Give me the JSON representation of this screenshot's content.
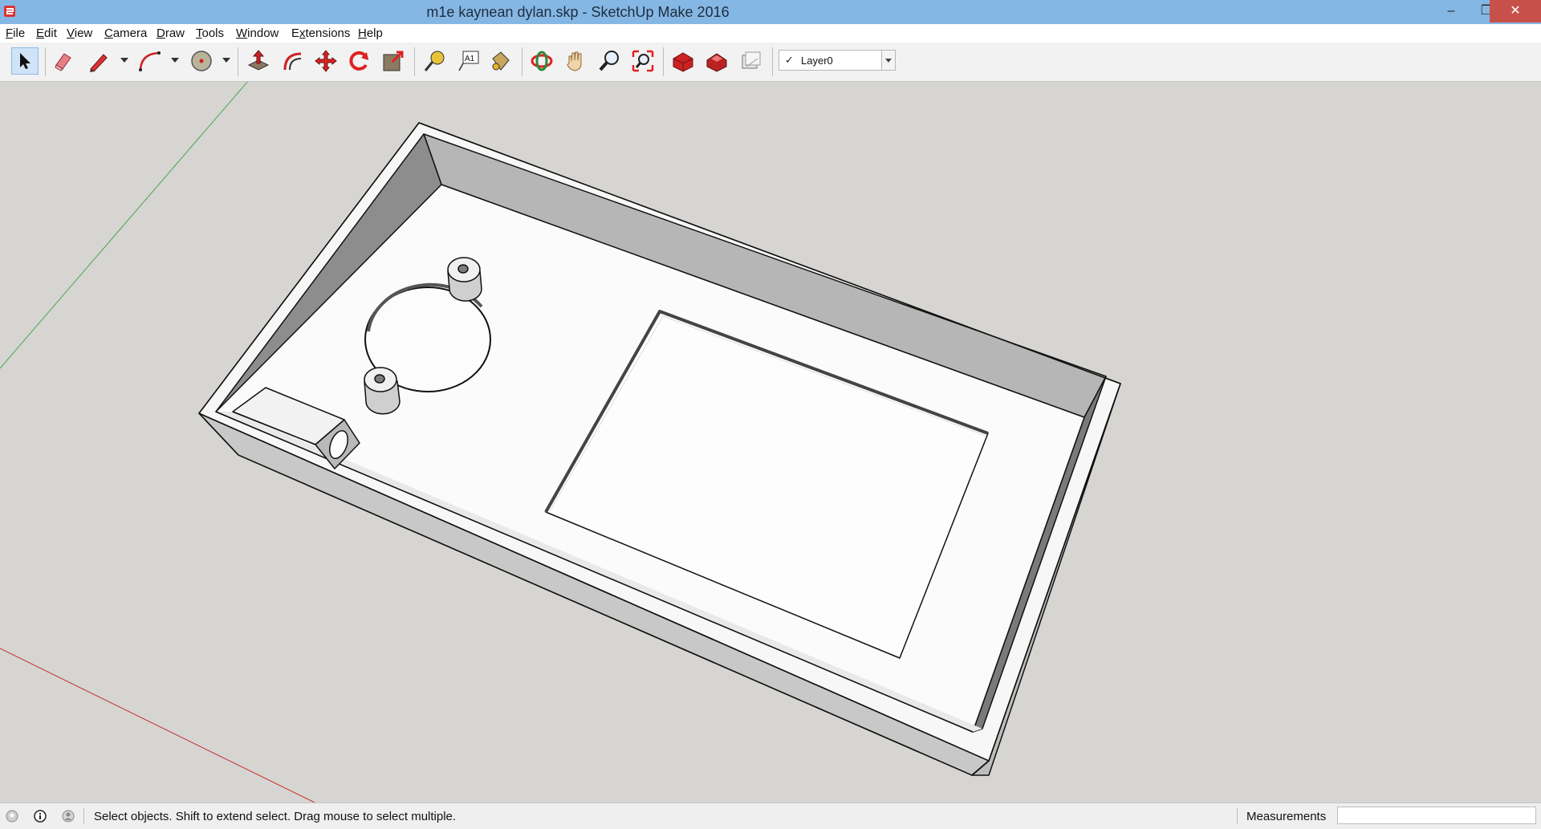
{
  "window": {
    "title": "m1e kaynean dylan.skp - SketchUp Make 2016",
    "minimize_glyph": "–",
    "maximize_glyph": "❐",
    "close_glyph": "✕"
  },
  "menu": {
    "items": [
      "File",
      "Edit",
      "View",
      "Camera",
      "Draw",
      "Tools",
      "Window",
      "Extensions",
      "Help"
    ],
    "mnemonics": [
      "F",
      "E",
      "V",
      "C",
      "D",
      "T",
      "W",
      "x",
      "H"
    ]
  },
  "toolbar": {
    "tools": [
      "select-icon",
      "eraser-icon",
      "line-pencil-icon",
      "arc-icon",
      "circle-icon",
      "push-pull-icon",
      "offset-icon",
      "move-icon",
      "rotate-icon",
      "scale-icon",
      "tape-measure-icon",
      "text-label-icon",
      "paint-bucket-icon",
      "orbit-icon",
      "pan-hand-icon",
      "zoom-icon",
      "zoom-extents-icon",
      "warehouse-icon",
      "extension-warehouse-icon",
      "layout-send-icon"
    ],
    "layer_selector": {
      "check": "✓",
      "value": "Layer0"
    }
  },
  "status": {
    "message": "Select objects. Shift to extend select. Drag mouse to select multiple.",
    "measurements_label": "Measurements",
    "measurements_value": ""
  },
  "colors": {
    "titlebar": "#85b7e4",
    "viewport": "#d6d5d2",
    "close_button": "#c7504a",
    "axis_green": "#4aa84a",
    "axis_red": "#c43030"
  }
}
